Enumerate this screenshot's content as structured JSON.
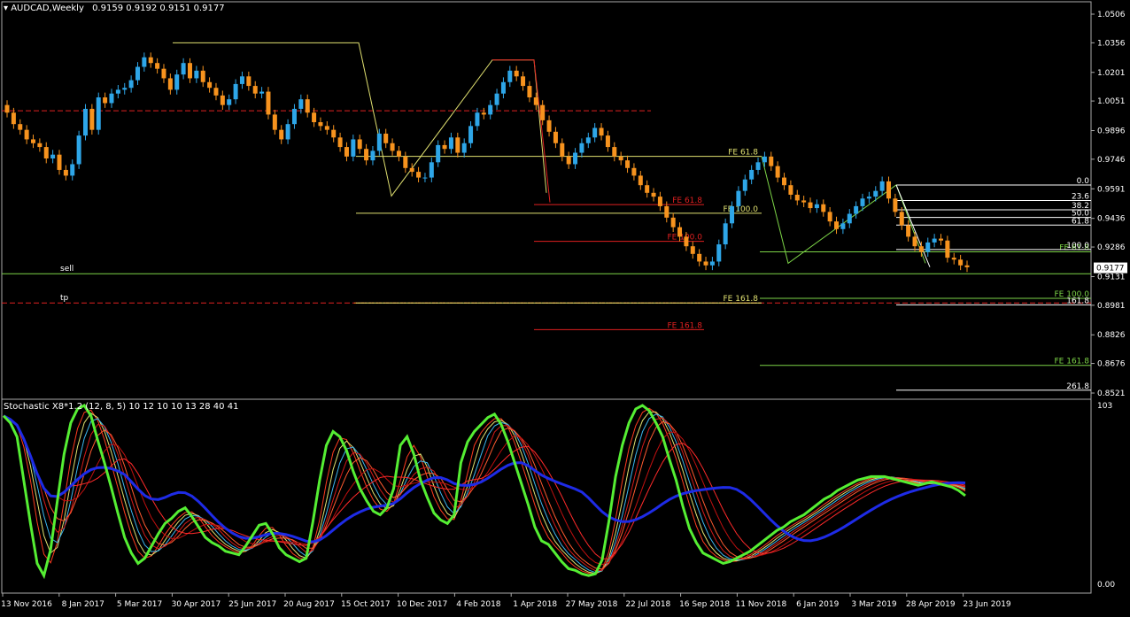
{
  "header": {
    "symbol_line": "AUDCAD,Weekly",
    "ohlc": "0.9159 0.9192 0.9151 0.9177"
  },
  "indicator_header": "Stochastic X8*1.2 (12, 8, 5) 10 12 10 10 13 28 40 41",
  "price_label": "0.9177",
  "text_labels": {
    "sell": "sell",
    "tp": "tp"
  },
  "colors": {
    "bull": "#2ea6e8",
    "bear": "#f7931e",
    "yellow": "#e0e070",
    "red": "#e02020",
    "green": "#7cd447",
    "white": "#ffffff",
    "stoch_fast": "#55ee33",
    "stoch_slow": "#1e2be6"
  },
  "chart_data": [
    {
      "type": "candlestick",
      "title": "AUDCAD,Weekly",
      "ylim": [
        0.8521,
        0.9128,
        1.0506
      ],
      "y_ticks": [
        "1.0506",
        "1.0356",
        "1.0201",
        "1.0051",
        "0.9896",
        "0.9746",
        "0.9591",
        "0.9436",
        "0.9286",
        "0.9131",
        "0.8981",
        "0.8826",
        "0.8676",
        "0.8521"
      ],
      "x_ticks": [
        "13 Nov 2016",
        "8 Jan 2017",
        "5 Mar 2017",
        "30 Apr 2017",
        "25 Jun 2017",
        "20 Aug 2017",
        "15 Oct 2017",
        "10 Dec 2017",
        "4 Feb 2018",
        "1 Apr 2018",
        "27 May 2018",
        "22 Jul 2018",
        "16 Sep 2018",
        "11 Nov 2018",
        "6 Jan 2019",
        "3 Mar 2019",
        "28 Apr 2019",
        "23 Jun 2019"
      ],
      "close_series": [
        0.999,
        0.993,
        0.99,
        0.985,
        0.983,
        0.981,
        0.975,
        0.977,
        0.969,
        0.966,
        0.972,
        0.987,
        1.001,
        0.99,
        1.007,
        1.004,
        1.009,
        1.011,
        1.012,
        1.016,
        1.023,
        1.028,
        1.025,
        1.022,
        1.017,
        1.011,
        1.019,
        1.025,
        1.017,
        1.021,
        1.015,
        1.012,
        1.008,
        1.003,
        1.006,
        1.014,
        1.018,
        1.013,
        1.009,
        1.01,
        0.998,
        0.99,
        0.985,
        0.993,
        1.001,
        1.006,
        0.999,
        0.994,
        0.992,
        0.99,
        0.986,
        0.981,
        0.976,
        0.985,
        0.98,
        0.974,
        0.979,
        0.988,
        0.983,
        0.979,
        0.976,
        0.97,
        0.968,
        0.965,
        0.965,
        0.973,
        0.982,
        0.98,
        0.986,
        0.978,
        0.983,
        0.992,
        0.999,
        0.998,
        1.003,
        1.009,
        1.015,
        1.021,
        1.018,
        1.013,
        1.007,
        1.003,
        0.995,
        0.989,
        0.983,
        0.976,
        0.972,
        0.978,
        0.983,
        0.986,
        0.991,
        0.987,
        0.981,
        0.976,
        0.974,
        0.97,
        0.966,
        0.961,
        0.957,
        0.955,
        0.95,
        0.944,
        0.939,
        0.934,
        0.929,
        0.925,
        0.921,
        0.919,
        0.921,
        0.93,
        0.941,
        0.95,
        0.958,
        0.964,
        0.969,
        0.973,
        0.976,
        0.971,
        0.965,
        0.961,
        0.956,
        0.953,
        0.952,
        0.949,
        0.951,
        0.947,
        0.942,
        0.938,
        0.941,
        0.946,
        0.95,
        0.954,
        0.955,
        0.958,
        0.963,
        0.954,
        0.947,
        0.94,
        0.934,
        0.929,
        0.926,
        0.931,
        0.933,
        0.932,
        0.923,
        0.922,
        0.919,
        0.918
      ],
      "series": [
        {
          "name": "Stochastic main",
          "values": [
            97,
            93,
            85,
            60,
            35,
            12,
            5,
            20,
            48,
            75,
            93,
            101,
            103,
            97,
            83,
            70,
            56,
            41,
            27,
            18,
            12,
            15,
            22,
            29,
            35,
            38,
            42,
            44,
            39,
            33,
            27,
            24,
            22,
            19,
            18,
            17,
            22,
            28,
            34,
            35,
            29,
            21,
            17,
            15,
            13,
            15,
            36,
            60,
            80,
            88,
            85,
            77,
            65,
            55,
            48,
            42,
            40,
            44,
            55,
            80,
            85,
            75,
            60,
            50,
            41,
            37,
            35,
            40,
            70,
            82,
            88,
            92,
            96,
            98,
            92,
            82,
            70,
            58,
            46,
            33,
            25,
            23,
            18,
            13,
            9,
            8,
            6,
            5,
            6,
            14,
            36,
            62,
            80,
            93,
            101,
            103,
            100,
            93,
            85,
            72,
            60,
            45,
            32,
            24,
            18,
            16,
            14,
            12,
            13,
            15,
            17,
            19,
            22,
            25,
            28,
            31,
            33,
            36,
            38,
            40,
            43,
            46,
            49,
            51,
            54,
            56,
            58,
            60,
            61,
            62,
            62,
            62,
            61,
            60,
            59,
            58,
            57,
            58,
            59,
            58,
            57,
            56,
            54,
            51
          ]
        }
      ],
      "indicator_ylim": [
        0,
        103
      ]
    }
  ]
}
